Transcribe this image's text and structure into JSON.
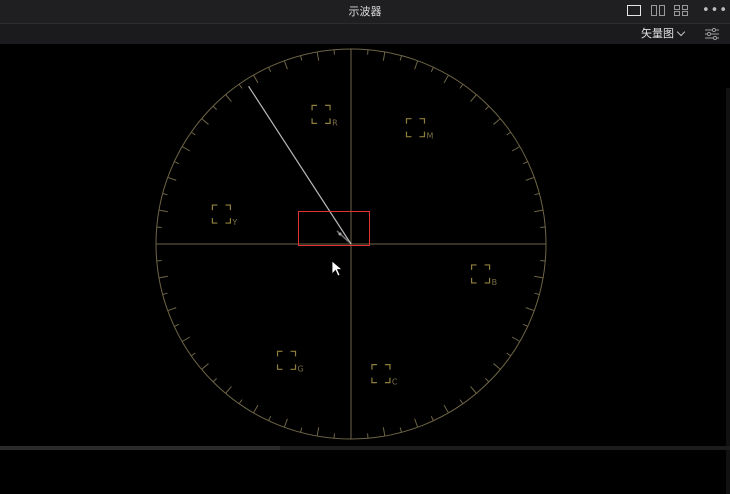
{
  "window": {
    "title": "示波器"
  },
  "layout_buttons": [
    "single-view",
    "dual-view",
    "quad-view"
  ],
  "toolbar": {
    "scope_mode": "矢量图"
  },
  "vectorscope": {
    "targets": [
      {
        "label": "R",
        "angle_deg": 103
      },
      {
        "label": "M",
        "angle_deg": 61
      },
      {
        "label": "B",
        "angle_deg": 347
      },
      {
        "label": "C",
        "angle_deg": 283
      },
      {
        "label": "G",
        "angle_deg": 241
      },
      {
        "label": "Y",
        "angle_deg": 167
      }
    ],
    "skin_tone_line_angle_deg": 123
  },
  "colors": {
    "graticule": "#6e6546",
    "target_box": "#8f7f3c",
    "target_label": "#7b6f46",
    "skin_line": "#d8d8d8",
    "selection": "#e03333"
  }
}
